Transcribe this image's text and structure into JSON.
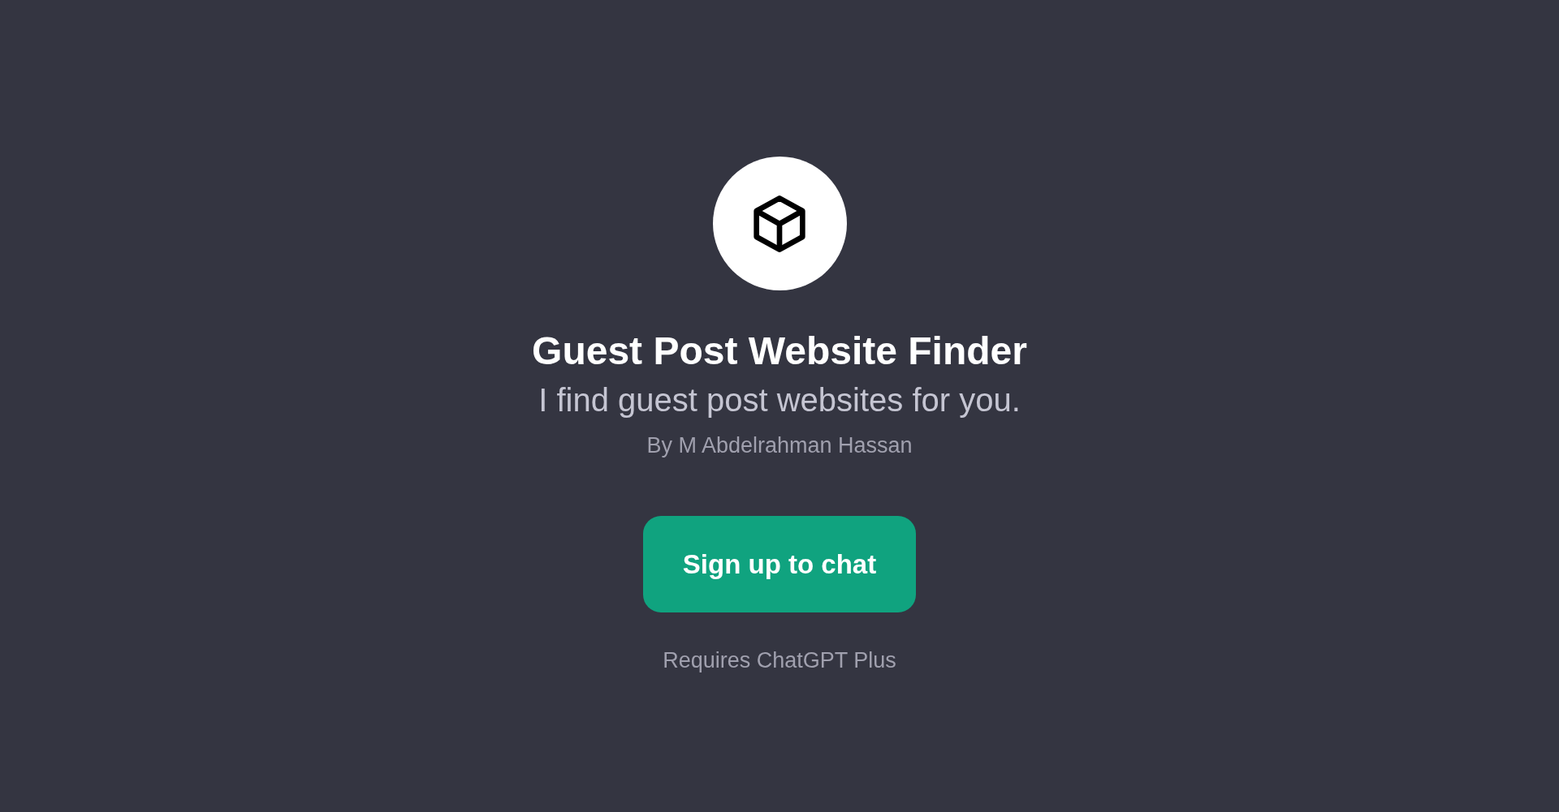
{
  "title": "Guest Post Website Finder",
  "description": "I find guest post websites for you.",
  "author": "By M Abdelrahman Hassan",
  "button": "Sign up to chat",
  "note": "Requires ChatGPT Plus"
}
